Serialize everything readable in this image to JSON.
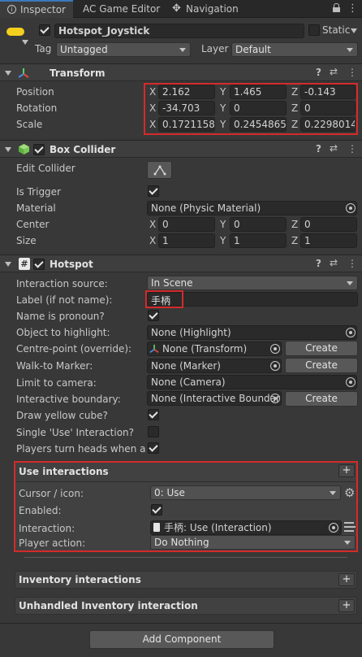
{
  "tabs": [
    {
      "label": "Inspector",
      "icon": "info-icon"
    },
    {
      "label": "AC Game Editor",
      "icon": ""
    },
    {
      "label": "Navigation",
      "icon": "navigation-icon"
    }
  ],
  "object": {
    "name": "Hotspot_Joystick",
    "static_label": "Static",
    "tag_label": "Tag",
    "tag_value": "Untagged",
    "layer_label": "Layer",
    "layer_value": "Default"
  },
  "transform": {
    "title": "Transform",
    "rows": [
      {
        "label": "Position",
        "x": "2.162",
        "y": "1.465",
        "z": "-0.143"
      },
      {
        "label": "Rotation",
        "x": "-34.703",
        "y": "0",
        "z": "0"
      },
      {
        "label": "Scale",
        "x": "0.1721158",
        "y": "0.2454865",
        "z": "0.2298014"
      }
    ]
  },
  "box_collider": {
    "title": "Box Collider",
    "edit_label": "Edit Collider",
    "is_trigger_label": "Is Trigger",
    "material_label": "Material",
    "material_value": "None (Physic Material)",
    "center_label": "Center",
    "center": {
      "x": "0",
      "y": "0",
      "z": "0"
    },
    "size_label": "Size",
    "size": {
      "x": "1",
      "y": "1",
      "z": "1"
    }
  },
  "axes": {
    "x": "X",
    "y": "Y",
    "z": "Z"
  },
  "hotspot": {
    "title": "Hotspot",
    "interaction_source_label": "Interaction source:",
    "interaction_source_value": "In Scene",
    "label_label": "Label (if not name):",
    "label_value": "手柄",
    "pronoun_label": "Name is pronoun?",
    "highlight_label": "Object to highlight:",
    "highlight_value": "None (Highlight)",
    "centre_label": "Centre-point (override):",
    "centre_value": "None (Transform)",
    "walkto_label": "Walk-to Marker:",
    "walkto_value": "None (Marker)",
    "camera_label": "Limit to camera:",
    "camera_value": "None (Camera)",
    "boundary_label": "Interactive boundary:",
    "boundary_value": "None (Interactive Boundar",
    "create_label": "Create",
    "yellow_cube_label": "Draw yellow cube?",
    "single_use_label": "Single 'Use' Interaction?",
    "turn_heads_label": "Players turn heads when act"
  },
  "use_interactions": {
    "title": "Use interactions",
    "cursor_label": "Cursor / icon:",
    "cursor_value": "0: Use",
    "enabled_label": "Enabled:",
    "interaction_label": "Interaction:",
    "interaction_value": "手柄: Use (Interaction)",
    "player_action_label": "Player action:",
    "player_action_value": "Do Nothing"
  },
  "inventory_interactions": {
    "title": "Inventory interactions"
  },
  "unhandled_inventory": {
    "title": "Unhandled Inventory interaction"
  },
  "add_component_label": "Add Component",
  "plus_label": "+",
  "accent": "#3a79bb",
  "highlight_color": "#d42a2a"
}
